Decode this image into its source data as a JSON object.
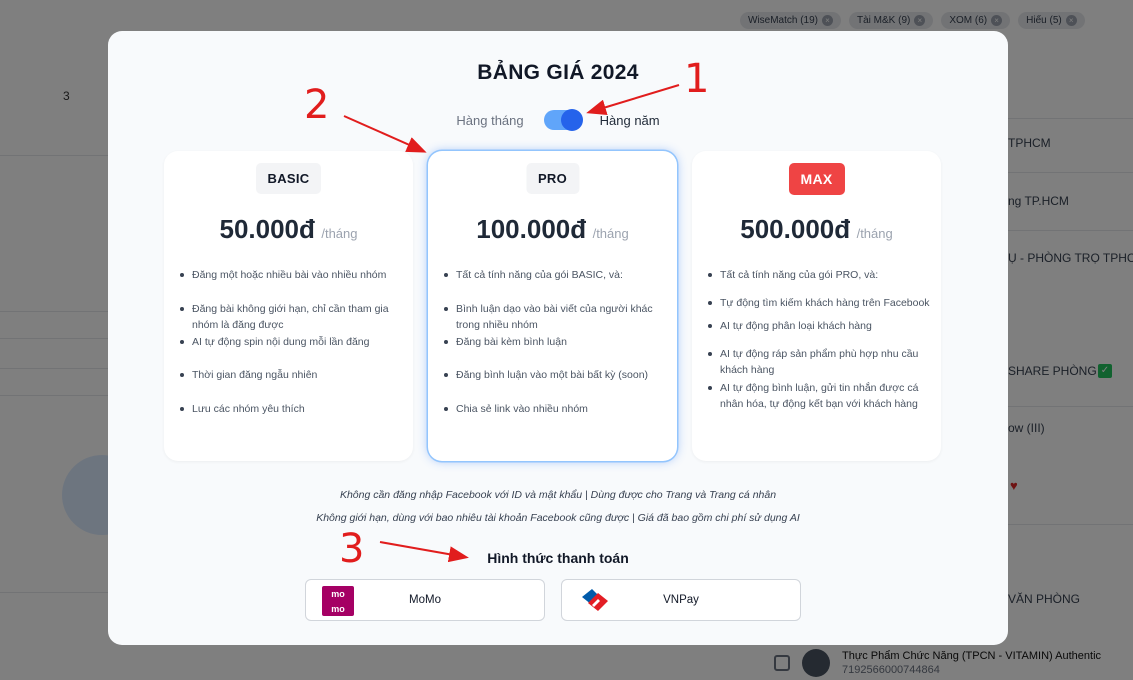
{
  "background": {
    "page_number": "3",
    "tags": [
      {
        "label": "WiseMatch (19)"
      },
      {
        "label": "Tài M&K (9)"
      },
      {
        "label": "XOM (6)"
      },
      {
        "label": "Hiếu (5)"
      }
    ],
    "right_rows": [
      "TPHCM",
      "ng TP.HCM",
      "Ụ - PHÒNG TRỌ TPHCM",
      "SHARE PHÒNG",
      "ow (III)",
      "VĂN PHÒNG"
    ],
    "bottom_item": {
      "title": "Thực Phẩm Chức Năng (TPCN - VITAMIN) Authentic",
      "id": "719256600074486​4"
    }
  },
  "modal": {
    "title": "BẢNG GIÁ 2024",
    "billing": {
      "monthly_label": "Hàng tháng",
      "yearly_label": "Hàng năm",
      "yearly_selected": true
    },
    "plans": [
      {
        "badge": "BASIC",
        "price": "50.000đ",
        "unit": "/tháng",
        "features": [
          "Đăng một hoặc nhiều bài vào nhiều nhóm",
          "Đăng bài không giới hạn, chỉ cần tham gia nhóm là đăng được",
          "AI tự động spin nội dung mỗi lần đăng",
          "Thời gian đăng ngẫu nhiên",
          "Lưu các nhóm yêu thích"
        ]
      },
      {
        "badge": "PRO",
        "price": "100.000đ",
        "unit": "/tháng",
        "features": [
          "Tất cả tính năng của gói BASIC, và:",
          "Bình luận dạo vào bài viết của người khác trong nhiều nhóm",
          "Đăng bài kèm bình luận",
          "Đăng bình luận vào một bài bất kỳ (soon)",
          "Chia sẻ link vào nhiều nhóm"
        ]
      },
      {
        "badge": "MAX",
        "price": "500.000đ",
        "unit": "/tháng",
        "features": [
          "Tất cả tính năng của gói PRO, và:",
          "Tự động tìm kiếm khách hàng trên Facebook",
          "AI tự động phân loại khách hàng",
          "AI tự động ráp sản phẩm phù hợp nhu cầu khách hàng",
          "AI tự động bình luận, gửi tin nhắn được cá nhân hóa, tự động kết bạn với khách hàng"
        ]
      }
    ],
    "notes": [
      "Không cần đăng nhập Facebook với ID và mật khẩu | Dùng được cho Trang và Trang cá nhân",
      "Không giới hạn, dùng với bao nhiêu tài khoản Facebook cũng được | Giá đã bao gồm chi phí sử dụng AI"
    ],
    "payment_title": "Hình thức thanh toán",
    "payment_methods": [
      {
        "label": "MoMo",
        "logo_text": [
          "mo",
          "mo"
        ]
      },
      {
        "label": "VNPay"
      }
    ]
  },
  "annotations": [
    "1",
    "2",
    "3"
  ],
  "colors": {
    "accent": "#2563eb",
    "annotation": "#e11d1d",
    "max_badge": "#ef4444",
    "momo": "#a50064"
  }
}
